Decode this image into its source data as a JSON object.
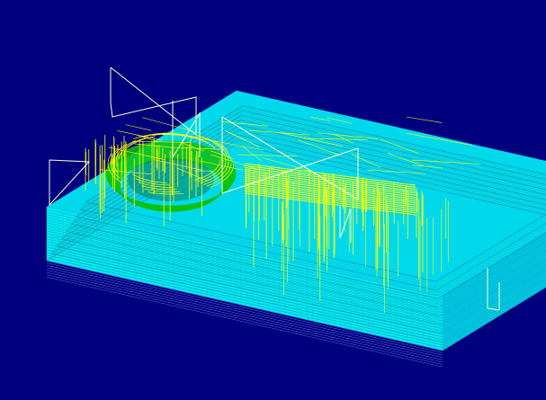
{
  "viewport": {
    "background_color": "#00007F",
    "mode": "wireframe-3d-view"
  },
  "model": {
    "type": "toolpath-wireframe",
    "layers": [
      {
        "name": "stock-block",
        "color": "#00FFFF"
      },
      {
        "name": "circular-pocket",
        "color": "#00C800"
      },
      {
        "name": "rapid-moves",
        "color": "#FFFF00"
      },
      {
        "name": "outline",
        "color": "#FFFFC8"
      }
    ]
  }
}
